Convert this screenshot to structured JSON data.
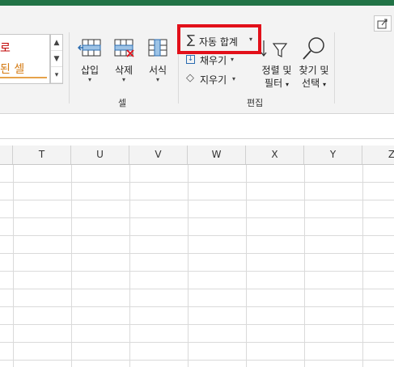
{
  "ribbon": {
    "styles_gallery": {
      "item1": "로",
      "item2": "된 셀"
    },
    "cells_group": {
      "label": "셀",
      "insert": "삽입",
      "delete": "삭제",
      "format": "서식"
    },
    "editing_group": {
      "label": "편집",
      "autosum": "자동 합계",
      "fill": "채우기",
      "clear": "지우기",
      "sort_filter": {
        "line1": "정렬 및",
        "line2": "필터"
      },
      "find_select": {
        "line1": "찾기 및",
        "line2": "선택"
      }
    },
    "highlight_color": "#e2101a"
  },
  "columns": [
    "T",
    "U",
    "V",
    "W",
    "X",
    "Y",
    "Z"
  ]
}
